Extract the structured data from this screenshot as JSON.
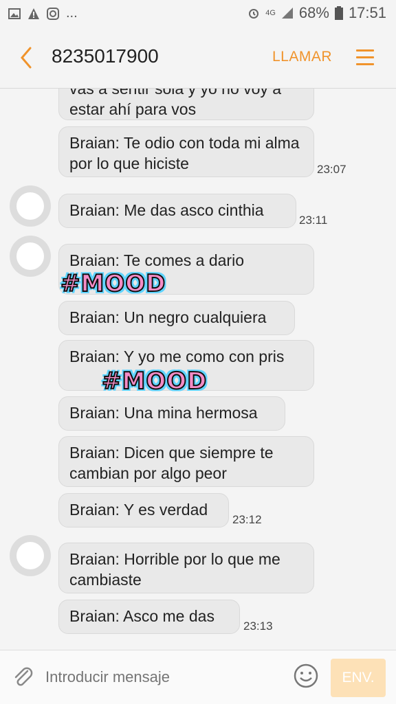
{
  "status_bar": {
    "more": "...",
    "network": "4G",
    "battery": "68%",
    "clock": "17:51"
  },
  "header": {
    "contact": "8235017900",
    "call_label": "LLAMAR"
  },
  "messages": [
    {
      "text": "vas a sentir sola y yo no voy a estar ahí para vos",
      "time": ""
    },
    {
      "text": "Braian: Te odio con toda mi alma por lo que hiciste",
      "time": "23:07"
    },
    {
      "text": "Braian: Me das asco cinthia",
      "time": "23:11"
    },
    {
      "text": "Braian: Te comes a dario",
      "time": ""
    },
    {
      "text": "Braian: Un negro cualquiera",
      "time": ""
    },
    {
      "text": "Braian: Y yo me como con pris",
      "time": ""
    },
    {
      "text": "Braian: Una mina hermosa",
      "time": ""
    },
    {
      "text": "Braian: Dicen que siempre te cambian por algo peor",
      "time": ""
    },
    {
      "text": "Braian: Y es verdad",
      "time": "23:12"
    },
    {
      "text": "Braian: Horrible por lo que me cambiaste",
      "time": ""
    },
    {
      "text": "Braian: Asco me das",
      "time": "23:13"
    }
  ],
  "stickers": [
    "#MOOD",
    "#MOOD"
  ],
  "composer": {
    "placeholder": "Introducir mensaje",
    "send_label": "ENV."
  },
  "colors": {
    "accent": "#f0932b",
    "bubble": "#e9e9e9",
    "sticker_fill": "#f48cc6",
    "sticker_outline": "#5fd4ff"
  }
}
